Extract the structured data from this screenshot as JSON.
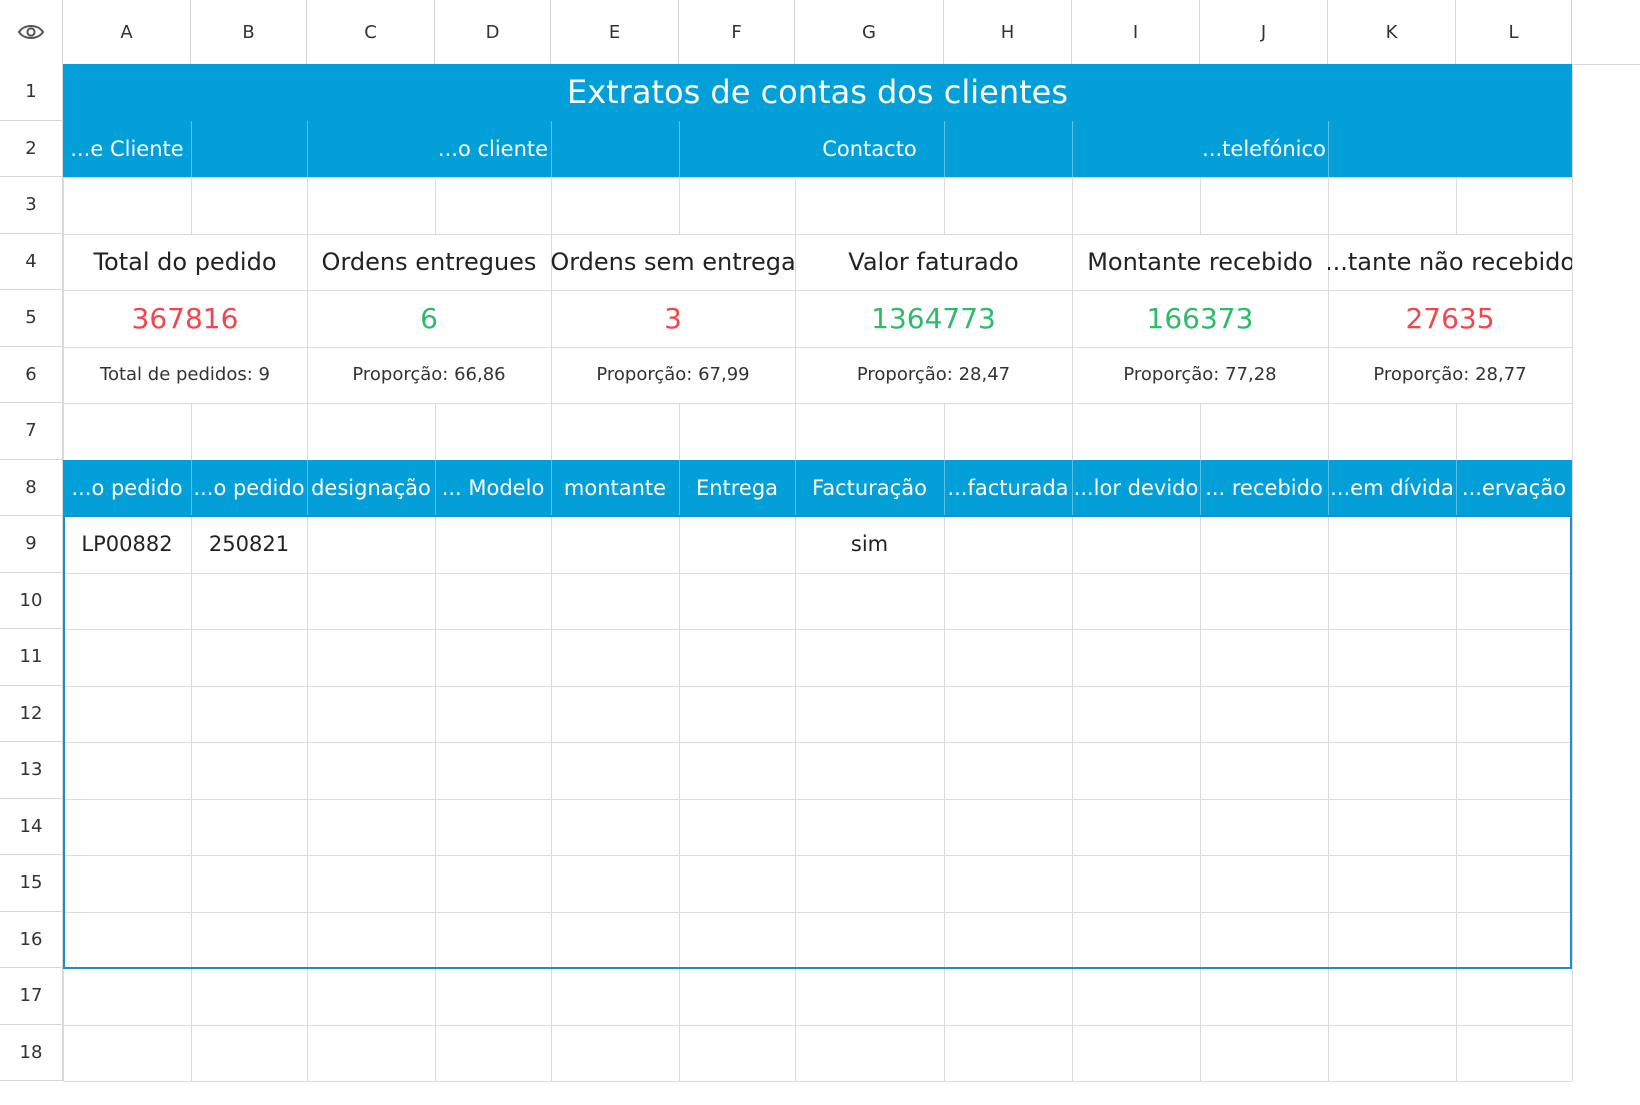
{
  "columns": [
    "A",
    "B",
    "C",
    "D",
    "E",
    "F",
    "G",
    "H",
    "I",
    "J",
    "K",
    "L"
  ],
  "rows": [
    "1",
    "2",
    "3",
    "4",
    "5",
    "6",
    "7",
    "8",
    "9",
    "10",
    "11",
    "12",
    "13",
    "14",
    "15",
    "16",
    "17",
    "18"
  ],
  "corner_icon": "eye-icon",
  "title": "Extratos de contas dos clientes",
  "info_header": {
    "a": "...e Cliente",
    "d": "...o cliente",
    "g": "Contacto",
    "j": "...telefónico"
  },
  "kpis": [
    {
      "label": "Total do pedido",
      "value": "367816",
      "value_color": "#f0474f",
      "note": "Total de pedidos: 9"
    },
    {
      "label": "Ordens entregues",
      "value": "6",
      "value_color": "#2fba6a",
      "note": "Proporção: 66,86"
    },
    {
      "label": "Ordens sem entrega",
      "value": "3",
      "value_color": "#f0474f",
      "note": "Proporção: 67,99"
    },
    {
      "label": "Valor faturado",
      "value": "1364773",
      "value_color": "#2fba6a",
      "note": "Proporção: 28,47"
    },
    {
      "label": "Montante recebido",
      "value": "166373",
      "value_color": "#2fba6a",
      "note": "Proporção: 77,28"
    },
    {
      "label": "...tante não recebido",
      "value": "27635",
      "value_color": "#f0474f",
      "note": "Proporção: 28,77"
    }
  ],
  "table_headers": [
    "...o pedido",
    "...o pedido",
    "designação",
    "... Modelo",
    "montante",
    "Entrega",
    "Facturação",
    "...facturada",
    "...lor devido",
    "... recebido",
    "...em dívida",
    "...ervação"
  ],
  "table_rows": [
    [
      "LP00882",
      "250821",
      "",
      "",
      "",
      "",
      "sim",
      "",
      "",
      "",
      "",
      ""
    ]
  ],
  "colors": {
    "accent_blue": "#029fd9",
    "table_outline": "#1a8fd0",
    "positive": "#2fba6a",
    "negative": "#f0474f"
  }
}
